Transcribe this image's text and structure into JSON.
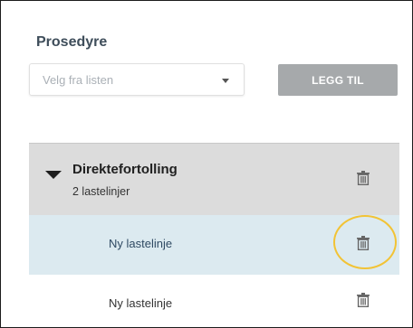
{
  "section": {
    "title": "Prosedyre"
  },
  "select": {
    "placeholder": "Velg fra listen"
  },
  "add_button": {
    "label": "LEGG TIL"
  },
  "group": {
    "title": "Direktefortolling",
    "subtitle": "2 lastelinjer",
    "expanded": true
  },
  "lines": [
    {
      "label": "Ny lastelinje",
      "selected": true
    },
    {
      "label": "Ny lastelinje",
      "selected": false
    }
  ],
  "colors": {
    "button_disabled": "#a6a9ab",
    "group_bg": "#dcdcdc",
    "selected_bg": "#dceaf0",
    "highlight": "#f2c335",
    "title": "#3e4d5a"
  },
  "icons": {
    "delete": "trash-icon",
    "expand": "caret-down-icon",
    "dropdown": "chevron-down-icon"
  }
}
